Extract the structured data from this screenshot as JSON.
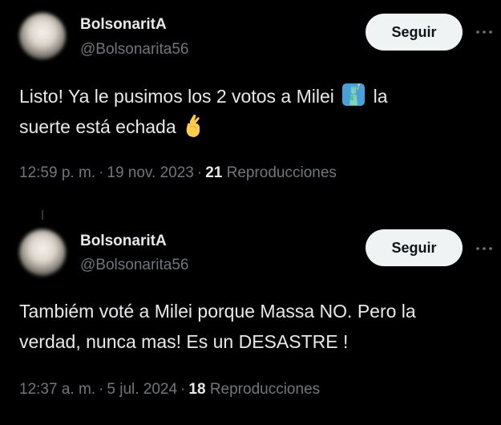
{
  "colors": {
    "background": "#000000",
    "primary_text": "#e7e9ea",
    "secondary_text": "#71767b",
    "follow_button_bg": "#eff3f4",
    "follow_button_text": "#0f1419"
  },
  "tweets": [
    {
      "author_name": "BolsonaritA",
      "author_handle": "@Bolsonarita56",
      "follow_label": "Seguir",
      "text_line1": "Listo! Ya le pusimos los 2 votos a Milei",
      "text_line1_end": "la",
      "text_line2": "suerte está echada",
      "emojis": [
        "statue-of-liberty-icon",
        "crossed-fingers-icon"
      ],
      "time": "12:59 p. m.",
      "date": "19 nov. 2023",
      "views_count": "21",
      "views_label": "Reproducciones",
      "separator": "·"
    },
    {
      "author_name": "BolsonaritA",
      "author_handle": "@Bolsonarita56",
      "follow_label": "Seguir",
      "text_line1": "Tambiém voté a Milei porque Massa NO. Pero la",
      "text_line2": "verdad, nunca mas! Es un DESASTRE !",
      "time": "12:37 a. m.",
      "date": "5 jul. 2024",
      "views_count": "18",
      "views_label": "Reproducciones",
      "separator": "·"
    }
  ]
}
